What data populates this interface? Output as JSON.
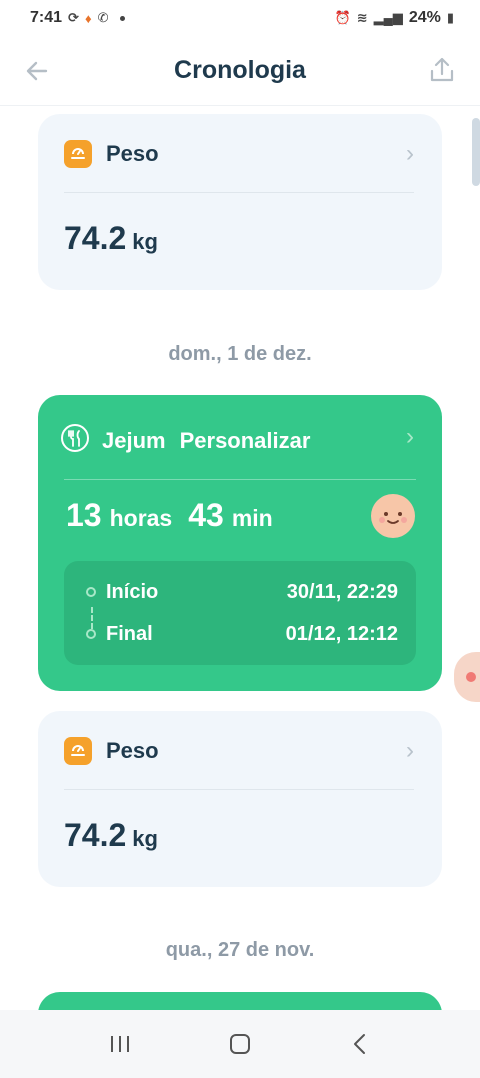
{
  "status_bar": {
    "time": "7:41",
    "battery": "24%"
  },
  "header": {
    "title": "Cronologia"
  },
  "timeline": {
    "weight_card_1": {
      "label": "Peso",
      "value": "74.2",
      "unit": "kg"
    },
    "date_1": "dom., 1 de dez.",
    "fast_card": {
      "label": "Jejum",
      "type": "Personalizar",
      "hours": "13",
      "hours_unit": "horas",
      "minutes": "43",
      "minutes_unit": "min",
      "start_label": "Início",
      "start_value": "30/11, 22:29",
      "end_label": "Final",
      "end_value": "01/12, 12:12"
    },
    "weight_card_2": {
      "label": "Peso",
      "value": "74.2",
      "unit": "kg"
    },
    "date_2": "qua., 27 de nov."
  },
  "colors": {
    "accent_green": "#34c88a",
    "weight_orange": "#f5a12b",
    "title_navy": "#1f3a4d"
  }
}
